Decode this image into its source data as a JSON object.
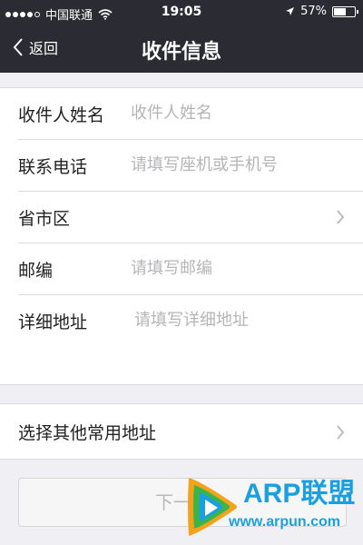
{
  "status_bar": {
    "carrier": "中国联通",
    "time": "19:05",
    "battery": "57%",
    "battery_level": 0.57,
    "icons": [
      "signal-dots",
      "wifi-icon",
      "location-arrow-icon",
      "battery-icon"
    ]
  },
  "nav": {
    "back_label": "返回",
    "title": "收件信息"
  },
  "form": {
    "rows": [
      {
        "label": "收件人姓名",
        "placeholder": "收件人姓名",
        "value": ""
      },
      {
        "label": "联系电话",
        "placeholder": "请填写座机或手机号",
        "value": ""
      },
      {
        "label": "省市区",
        "value": ""
      },
      {
        "label": "邮编",
        "placeholder": "请填写邮编",
        "value": ""
      },
      {
        "label": "详细地址",
        "placeholder": "请填写详细地址",
        "value": ""
      }
    ]
  },
  "other_address": {
    "label": "选择其他常用地址"
  },
  "next_button": {
    "label": "下一步"
  },
  "watermark": {
    "logo_text": "ARP联盟",
    "url": "www.arpun.com"
  },
  "colors": {
    "nav_bg": "#2b2b33",
    "page_bg": "#efeff4",
    "placeholder": "#b5b5b8",
    "brand_blue": "#1a9fe0"
  }
}
